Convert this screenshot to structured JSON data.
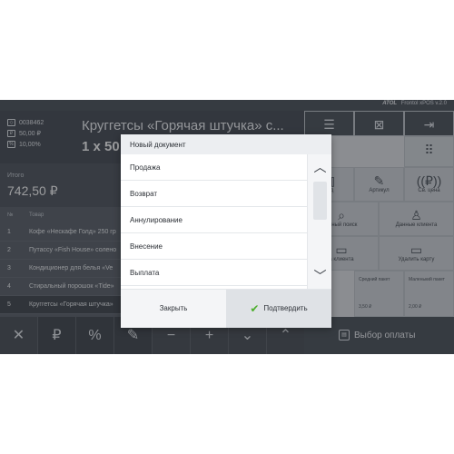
{
  "topbar": {
    "brand_logo": "ATOL",
    "brand_text": "Frontol xPOS v.2.0"
  },
  "product": {
    "code": "0038462",
    "price": "50,00 ₽",
    "discount": "10,00%",
    "name": "Круггетсы «Горячая штучка» с...",
    "qty": "1 x 50"
  },
  "totals": {
    "label": "Итого",
    "value": "742,50 ₽"
  },
  "table": {
    "headers": [
      "№",
      "Товар"
    ],
    "rows": [
      {
        "n": "1",
        "name": "Кофе «Нескафе Голд» 250 гр"
      },
      {
        "n": "2",
        "name": "Путассу «Fish House» солено"
      },
      {
        "n": "3",
        "name": "Кондиционер для белья «Ve"
      },
      {
        "n": "4",
        "name": "Стиральный порошок «Tide»"
      },
      {
        "n": "5",
        "name": "Круггетсы «Горячая штучка»"
      }
    ]
  },
  "bottom_buttons": [
    "✕",
    "₽",
    "%",
    "✎",
    "−",
    "+",
    "⌄",
    "⌃"
  ],
  "right": {
    "buttons": [
      {
        "label": "ход",
        "icon": "barcode-icon"
      },
      {
        "label": "Артикул",
        "icon": "article-icon"
      },
      {
        "label": "Св. цена",
        "icon": "price-icon"
      },
      {
        "label": "льный поиск",
        "icon": "search-icon"
      },
      {
        "label": "Данные клиента",
        "icon": "client-data-icon"
      },
      {
        "label": "а клиента",
        "icon": "card-icon"
      },
      {
        "label": "Удалить карту",
        "icon": "remove-card-icon"
      }
    ],
    "packages": [
      {
        "label": "Средний пакет",
        "price": "3,50 ₽"
      },
      {
        "label": "Маленький пакет",
        "price": "2,00 ₽"
      }
    ],
    "payment_label": "Выбор оплаты"
  },
  "dialog": {
    "title": "Новый документ",
    "options": [
      "Продажа",
      "Возврат",
      "Аннулирование",
      "Внесение",
      "Выплата"
    ],
    "close_label": "Закрыть",
    "confirm_label": "Подтвердить"
  }
}
